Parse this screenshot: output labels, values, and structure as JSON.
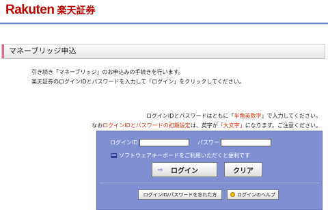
{
  "header": {
    "logo_en": "Rakuten",
    "logo_jp": "楽天証券"
  },
  "page": {
    "title": "マネーブリッジ申込"
  },
  "intro": {
    "line1": "引き続き「マネーブリッジ」のお申込みの手続きを行います。",
    "line2": "楽天証券のログインIDとパスワードを入力して「ログイン」をクリックしてください。"
  },
  "notice": {
    "line1_a": "ログインIDとパスワードはともに「",
    "line1_red": "半角英数字",
    "line1_b": "」で入力してください。",
    "line2_a": "なお",
    "line2_red1": "ログインIDとパスワードの初期設定",
    "line2_b": "は、英字が",
    "line2_red2": "「大文字」",
    "line2_c": "になります。ご注意ください。"
  },
  "login": {
    "id_label": "ログインID",
    "id_value": "",
    "pw_label": "パスワード",
    "pw_value": "",
    "keyboard_text": "ソフトウェアキーボードをご利用いただくと便利です",
    "login_button": "ログイン",
    "clear_button": "クリア",
    "forgot_button": "ログインID/パスワードを忘れた方",
    "help_button": "ログインのヘルプ"
  },
  "icons": {
    "keyboard": "keyboard-icon",
    "arrow": "arrow-right-icon",
    "help": "help-icon"
  },
  "colors": {
    "brand": "#bf0000",
    "panel": "#7f8fd2",
    "highlight": "#e0300a"
  }
}
